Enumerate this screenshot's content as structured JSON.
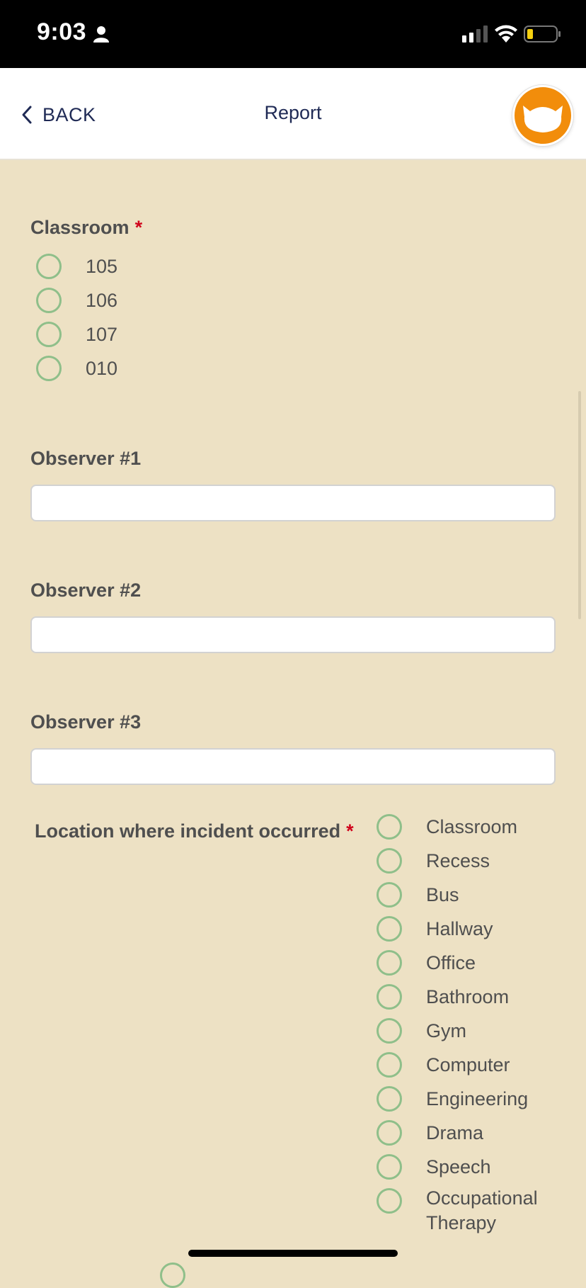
{
  "status_bar": {
    "time": "9:03"
  },
  "nav": {
    "back_label": "BACK",
    "title": "Report",
    "accent": "#f28d0b",
    "text_color": "#1f2a55"
  },
  "form": {
    "classroom": {
      "label": "Classroom",
      "required_mark": "*",
      "options": [
        "105",
        "106",
        "107",
        "010"
      ]
    },
    "observer1": {
      "label": "Observer #1",
      "value": ""
    },
    "observer2": {
      "label": "Observer #2",
      "value": ""
    },
    "observer3": {
      "label": "Observer #3",
      "value": ""
    },
    "location": {
      "label": "Location where incident occurred",
      "required_mark": "*",
      "options": [
        "Classroom",
        "Recess",
        "Bus",
        "Hallway",
        "Office",
        "Bathroom",
        "Gym",
        "Computer",
        "Engineering",
        "Drama",
        "Speech",
        "Occupational Therapy"
      ]
    }
  },
  "colors": {
    "background": "#ede1c4",
    "radio_border": "#8fbf8a",
    "required": "#d0021b"
  }
}
